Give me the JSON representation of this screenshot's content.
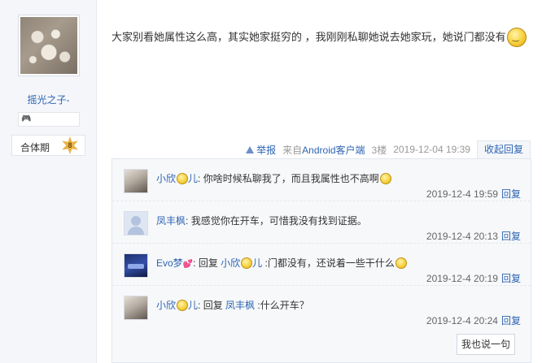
{
  "author": {
    "username": "摇光之子-",
    "level_name": "合体期",
    "level_number": "8"
  },
  "post": {
    "content": "大家别看她属性这么高，其实她家挺穷的 ，我刚刚私聊她说去她家玩，她说门都没有",
    "report_label": "举报",
    "client_prefix": "来自",
    "client_name": "Android客户端",
    "floor": "3楼",
    "time": "2019-12-04 19:39",
    "collapse_label": "收起回复"
  },
  "replies": [
    {
      "user": "小欣",
      "user_suffix": "儿",
      "separator": ": ",
      "reply_word": "",
      "target": "",
      "target_suffix": "",
      "text": "你啥时候私聊我了，而且我属性也不高啊",
      "time": "2019-12-4 19:59",
      "reply_label": "回复"
    },
    {
      "user": "凤丰枫",
      "user_suffix": "",
      "separator": ": ",
      "reply_word": "",
      "target": "",
      "target_suffix": "",
      "text": "我感觉你在开车，可惜我没有找到证据。",
      "time": "2019-12-4 20:13",
      "reply_label": "回复"
    },
    {
      "user": "Evo梦",
      "user_suffix": "",
      "separator": ": ",
      "reply_word": "回复 ",
      "target": "小欣",
      "target_suffix": "儿",
      "text": " :门都没有，还说着一些干什么",
      "time": "2019-12-4 20:19",
      "reply_label": "回复"
    },
    {
      "user": "小欣",
      "user_suffix": "儿",
      "separator": ": ",
      "reply_word": "回复 ",
      "target": "凤丰枫",
      "target_suffix": "",
      "text": " :什么开车？",
      "time": "2019-12-4 20:24",
      "reply_label": "回复"
    }
  ],
  "reply_box_button": "我也说一句",
  "colors": {
    "link": "#2d64b3",
    "sidebar_bg": "#f4f6f9",
    "reply_area_bg": "#f7f8fa"
  }
}
